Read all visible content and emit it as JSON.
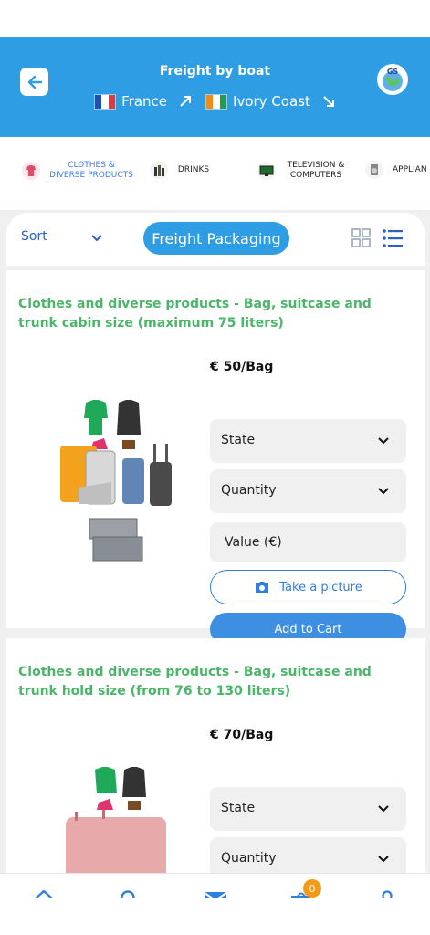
{
  "header": {
    "title": "Freight by boat",
    "origin": "France",
    "destination": "Ivory Coast",
    "logo_text": "GS",
    "color": "#2f9de4"
  },
  "categories": [
    {
      "label": "CLOTHES & DIVERSE PRODUCTS",
      "icon": "clothes-icon",
      "active": true
    },
    {
      "label": "DRINKS",
      "icon": "bottles-icon",
      "active": false
    },
    {
      "label": "TELEVISION & COMPUTERS",
      "icon": "tv-icon",
      "active": false
    },
    {
      "label": "APPLIAN",
      "icon": "appliance-icon",
      "active": false
    }
  ],
  "toolbar": {
    "sort_label": "Sort",
    "packaging_label": "Freight Packaging"
  },
  "products": [
    {
      "title": "Clothes and diverse products - Bag, suitcase and trunk cabin size (maximum 75 liters)",
      "price": "€ 50/Bag",
      "state_label": "State",
      "quantity_label": "Quantity",
      "value_placeholder": "Value (€)",
      "picture_label": "Take a picture",
      "cart_label": "Add to Cart"
    },
    {
      "title": "Clothes and diverse products - Bag, suitcase and trunk hold size (from 76 to 130 liters)",
      "price": "€ 70/Bag",
      "state_label": "State",
      "quantity_label": "Quantity"
    }
  ],
  "nav": {
    "items": [
      "home-icon",
      "search-icon",
      "mail-icon",
      "cart-icon",
      "user-icon"
    ],
    "cart_count": "0",
    "accent": "#2f7fe0",
    "badge_color": "#f59a14"
  }
}
